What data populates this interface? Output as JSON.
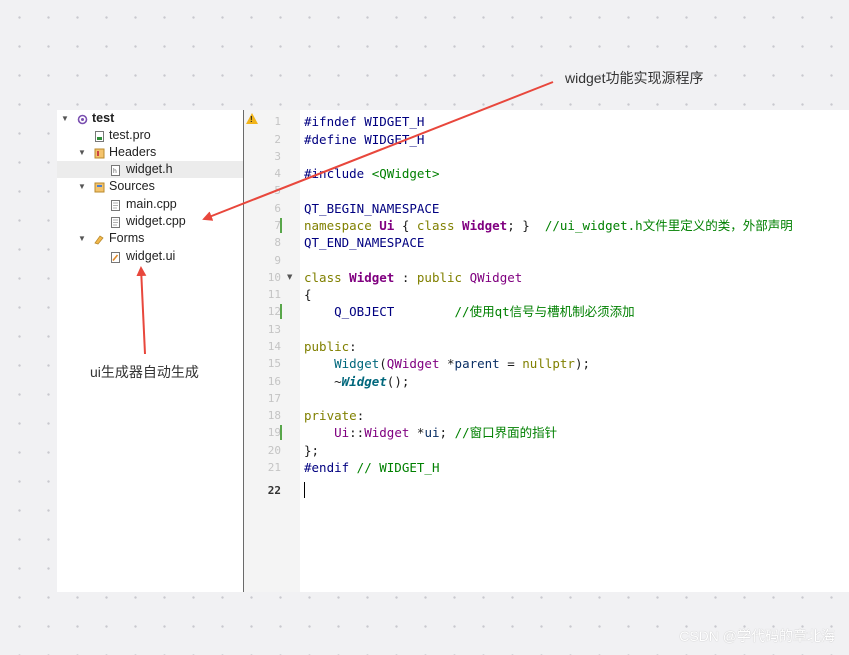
{
  "project_tree": {
    "project": "test",
    "pro_file": "test.pro",
    "headers_label": "Headers",
    "header_file": "widget.h",
    "sources_label": "Sources",
    "source_main": "main.cpp",
    "source_widget": "widget.cpp",
    "forms_label": "Forms",
    "form_file": "widget.ui"
  },
  "editor": {
    "line_numbers": [
      "1",
      "2",
      "3",
      "4",
      "5",
      "6",
      "7",
      "8",
      "9",
      "10",
      "11",
      "12",
      "13",
      "14",
      "15",
      "16",
      "17",
      "18",
      "19",
      "20",
      "21",
      "22"
    ],
    "current_line": "22",
    "code": {
      "l1_directive": "#ifndef",
      "l1_macro": " WIDGET_H",
      "l2_directive": "#define",
      "l2_macro": " WIDGET_H",
      "l4_directive": "#include",
      "l4_header": " <QWidget>",
      "l6_macro": "QT_BEGIN_NAMESPACE",
      "l7_kw": "namespace",
      "l7_ns": " Ui",
      "l7_brace_open": " { ",
      "l7_class_kw": "class",
      "l7_class": " Widget",
      "l7_brace_close": "; }  ",
      "l7_comment": "//ui_widget.h文件里定义的类，外部声明",
      "l8_macro": "QT_END_NAMESPACE",
      "l10_kw": "class",
      "l10_class": " Widget",
      "l10_colon": " : ",
      "l10_public": "public",
      "l10_base": " QWidget",
      "l11": "{",
      "l12_macro": "    Q_OBJECT",
      "l12_comment": "        //使用qt信号与槽机制必须添加",
      "l14_kw": "public",
      "l14_colon": ":",
      "l15_fn": "    Widget",
      "l15_paren": "(",
      "l15_type": "QWidget",
      "l15_star": " *",
      "l15_param": "parent",
      "l15_eq": " = ",
      "l15_null": "nullptr",
      "l15_end": ");",
      "l16_tilde": "    ~",
      "l16_fn": "Widget",
      "l16_end": "();",
      "l18_kw": "private",
      "l18_colon": ":",
      "l19_ns": "    Ui",
      "l19_sep": "::",
      "l19_type": "Widget",
      "l19_star": " *",
      "l19_var": "ui",
      "l19_semi": "; ",
      "l19_comment": "//窗口界面的指针",
      "l20": "};",
      "l21_directive": "#endif",
      "l21_comment": " // WIDGET_H"
    }
  },
  "annotations": {
    "source_note": "widget功能实现源程序",
    "ui_note": "ui生成器自动生成"
  },
  "watermark": "CSDN @学代码的章北海",
  "colors": {
    "arrow": "#e8473c",
    "keyword": "#808000",
    "type": "#800080",
    "comment": "#008000",
    "preprocessor": "#000080",
    "warning": "#f1b41b",
    "changed_line_marker": "#58a64a"
  }
}
